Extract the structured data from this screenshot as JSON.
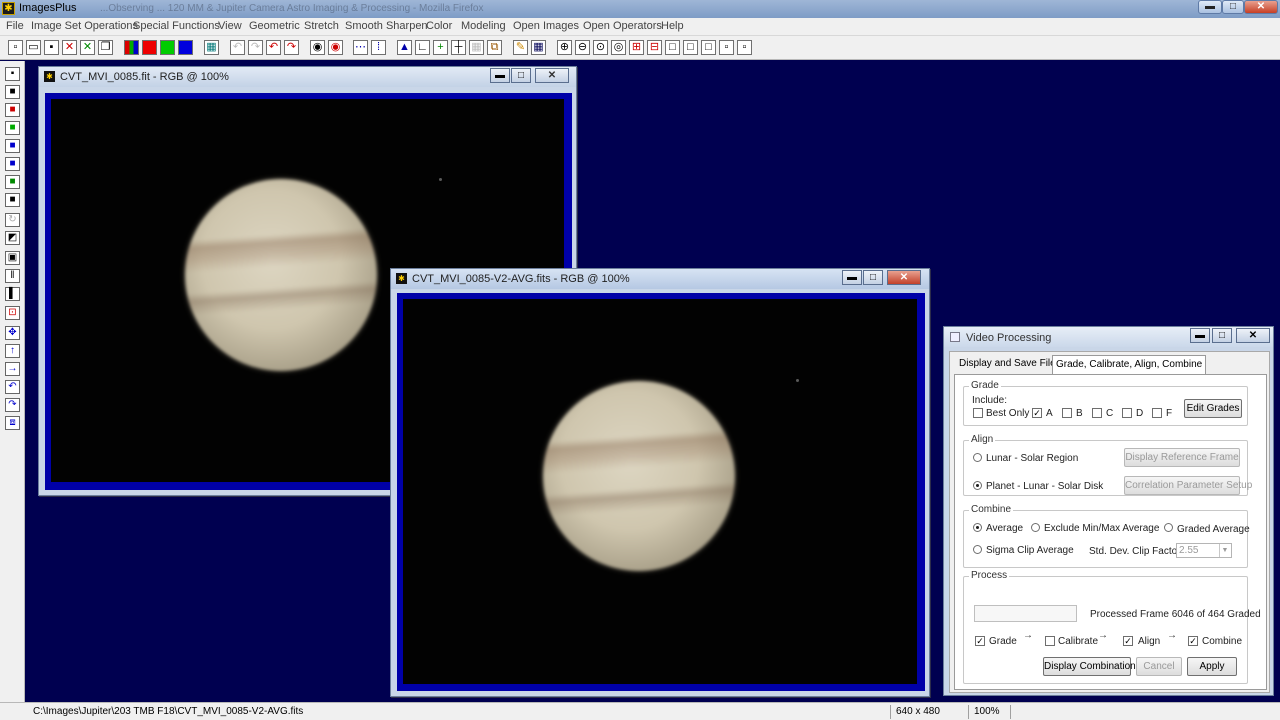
{
  "app": {
    "title": "ImagesPlus",
    "ghost_title": "...Observing ... 120 MM & Jupiter Camera Astro Imaging & Processing - Mozilla Firefox"
  },
  "menu": [
    "File",
    "Image Set Operations",
    "Special Functions",
    "View",
    "Geometric",
    "Stretch",
    "Smooth Sharpen",
    "Color",
    "Modeling",
    "Open Images",
    "Open Operators",
    "Help"
  ],
  "windows": {
    "back": {
      "title": "CVT_MVI_0085.fit - RGB @ 100%"
    },
    "front": {
      "title": "CVT_MVI_0085-V2-AVG.fits - RGB @ 100%"
    }
  },
  "dialog": {
    "title": "Video Processing",
    "tabs": [
      "Display and Save Files",
      "Grade, Calibrate, Align,  Combine"
    ],
    "grade": {
      "label": "Grade",
      "include": "Include:",
      "best_only": "Best Only",
      "grades": [
        "A",
        "B",
        "C",
        "D",
        "F"
      ],
      "edit_btn": "Edit Grades"
    },
    "align": {
      "label": "Align",
      "lunar_region": "Lunar - Solar Region",
      "planet_disk": "Planet - Lunar - Solar Disk",
      "display_ref_btn": "Display Reference Frame",
      "corr_btn": "Correlation Parameter Setup"
    },
    "combine": {
      "label": "Combine",
      "average": "Average",
      "exclude": "Exclude Min/Max Average",
      "graded": "Graded Average",
      "sigma": "Sigma Clip Average",
      "clip_label": "Std. Dev. Clip Factor:",
      "clip_value": "2.55"
    },
    "process": {
      "label": "Process",
      "status": "Processed Frame 6046 of 464 Graded",
      "grade": "Grade",
      "calibrate": "Calibrate",
      "align": "Align",
      "combine": "Combine",
      "display_btn": "Display Combination",
      "cancel_btn": "Cancel",
      "apply_btn": "Apply"
    }
  },
  "status": {
    "path": "C:\\Images\\Jupiter\\203 TMB F18\\CVT_MVI_0085-V2-AVG.fits",
    "size": "640 x 480",
    "zoom": "100%"
  }
}
